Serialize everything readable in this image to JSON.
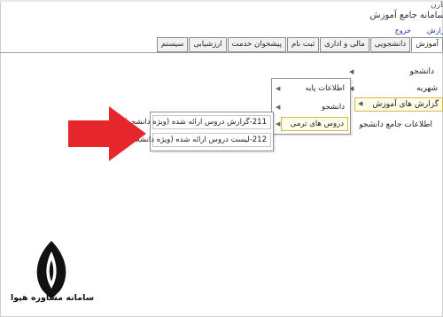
{
  "header": {
    "user_name": "گارن",
    "app_title": "سامانه جامع آموزش",
    "logout": "خروج",
    "report_label": "گزارش"
  },
  "menubar": {
    "tabs": [
      {
        "label": "آموزش",
        "active": true
      },
      {
        "label": "دانشجویی"
      },
      {
        "label": "مالی و اداری"
      },
      {
        "label": "ثبت نام"
      },
      {
        "label": "پیشخوان خدمت"
      },
      {
        "label": "ارزشیابی"
      },
      {
        "label": "سیستم"
      }
    ]
  },
  "sidebar": {
    "items": [
      {
        "label": "دانشجو"
      },
      {
        "label": "شهریه"
      },
      {
        "label": "گزارش های آموزش",
        "selected": true
      },
      {
        "label": "اطلاعات جامع دانشجو"
      }
    ]
  },
  "submenu1": {
    "items": [
      {
        "label": "اطلاعات پایه"
      },
      {
        "label": "دانشجو"
      },
      {
        "label": "دروس های ترمی",
        "highlighted": true
      }
    ]
  },
  "submenu2": {
    "items": [
      {
        "label": "211-گزارش دروس ارائه شده (ویژه دانشجو)"
      },
      {
        "label": "212-لیست دروس ارائه شده (ویژه دانشجو)"
      }
    ]
  },
  "logo": {
    "caption": "سامانه مشاوره هپوا"
  },
  "colors": {
    "arrow": "#e5262b",
    "highlight_border": "#d4b64a",
    "link": "#1a3fa8"
  }
}
